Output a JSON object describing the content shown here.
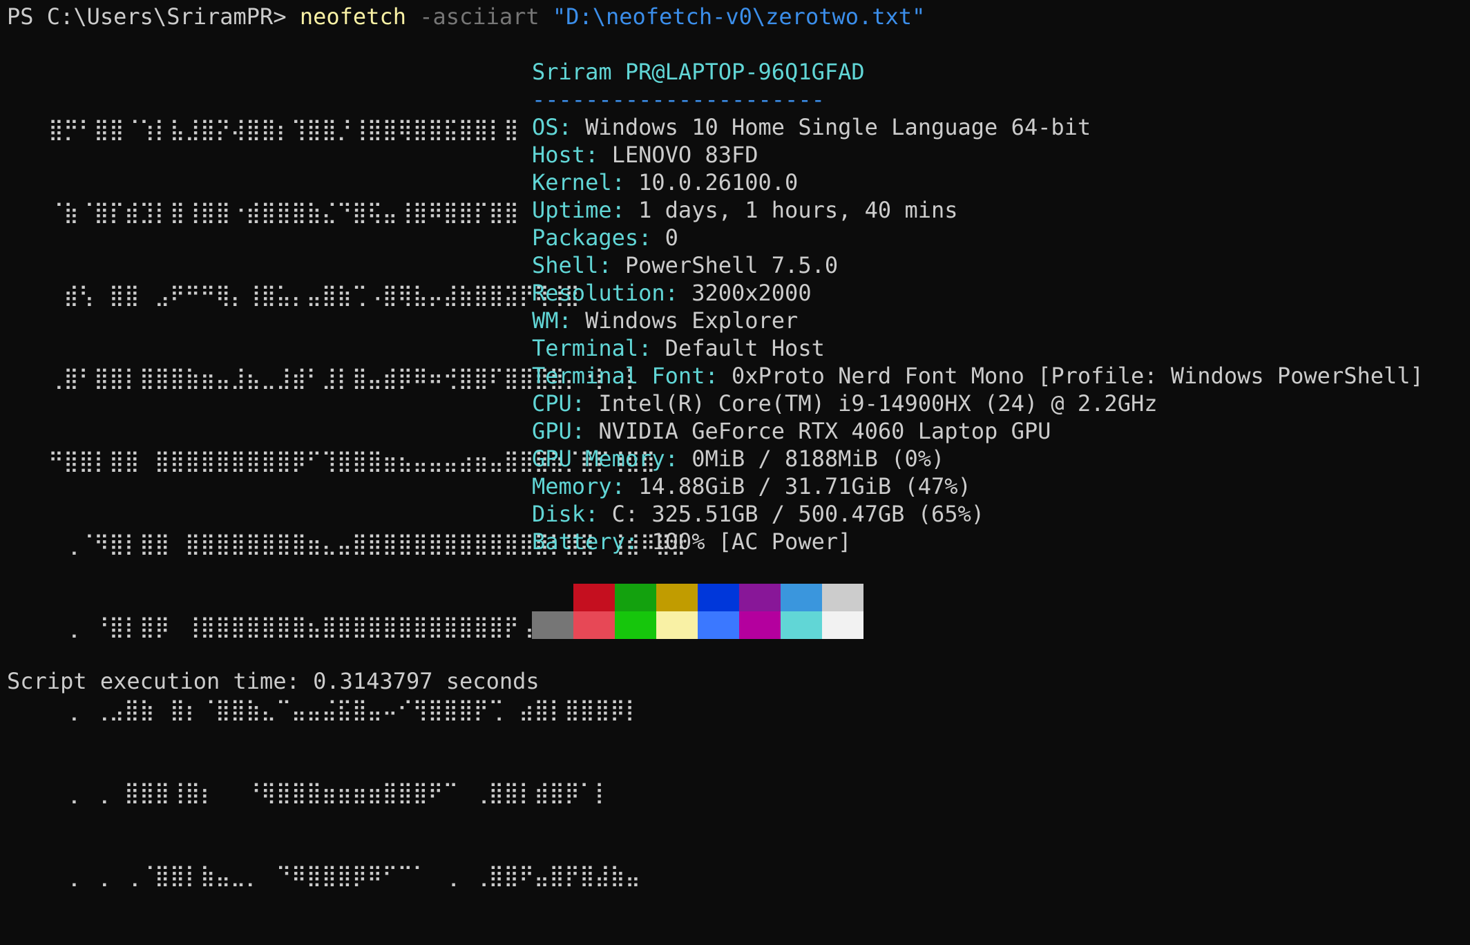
{
  "window": {
    "background": "#0c0c0c"
  },
  "prompt": {
    "ps": "PS C:\\Users\\SriramPR> ",
    "command": "neofetch",
    "flag": " -asciiart ",
    "argument": "\"D:\\neofetch-v0\\zerotwo.txt\""
  },
  "ascii_art": [
    "⣿⡛⠃⣿⣿⠈⢱⡇⣧⣸⣿⡝⢼⣿⣿⡆⢹⣿⣿⡘⢸⣿⣿⢿⣿⣿⣯⣿⣿⡇⣿",
    "⠈⣷⠈⣿⡏⣾⣹⡇⣿⢸⣿⣿⠐⣾⣿⣿⣿⣷⣌⠙⣿⢯⣤⢸⣿⠿⣿⣿⡏⣿⣿",
    "⠀⣾⢣⠀⣿⣿⠀⣠⠟⠛⠛⢿⡄⢸⣿⣥⡄⣤⣿⣷⢉⠠⣿⢿⣧⡤⣼⣷⣿⣿⣽⡟⢿⢸⣿",
    "⢀⣿⠃⣿⣿⡇⣿⣿⣿⣷⣶⣤⣸⣦⣀⣸⣾⠃⣸⡇⣿⣤⣾⡿⠿⠶⢚⣿⣿⠏⣿⣿⣿⣿⡄⠐⡇⠀⡇",
    "⠛⣿⣿⡇⣿⣿⠀⣿⣿⣿⣿⣿⣿⣿⣿⣿⡿⠋⢹⣿⣿⣿⣶⣦⣤⣤⣤⣴⣶⣤⣿⣿⣿⣷⡈⣿⡏⢸⣿⣿",
    "⠀⢀⠈⠻⣿⡇⣿⣿⠀⣿⣿⣿⣿⣿⣿⣿⣿⣶⣄⣤⣿⣿⣿⣿⣿⣿⣿⣿⣿⣿⣿⣿⣿⡇⣿⣿⠀⢸⣾⠿⣿⣿",
    "⠀⢀⠀⠘⣿⡇⣿⡿⠀⢸⣿⣿⣿⣿⣿⣿⣿⣦⣿⣿⣿⣿⣿⣿⣿⣿⣿⣿⣿⣿⡟⢠⣿⢿⣿⣿⣿⣿⠀⠀",
    "⠀⢀⠀⢀⣠⣿⣷⠀⣿⡆⠈⣿⣿⣷⣄⠉⣤⣤⣬⣯⣿⣤⠤⠊⢻⣿⣿⣿⡟⢉⠀⣴⣿⡇⣿⣿⣿⡿⡇⠀",
    "⠀⢀⠀⢀⠀⣿⣿⣿⢸⣿⡆⠀⠀⠘⢿⣿⣿⣿⣶⣶⣶⣶⣿⣿⣿⠟⠉⠀⢀⣿⣿⡇⣾⣿⡿⠁⡇⠀",
    "⠀⢀⠀⢀⠀⢀⠈⣿⣿⡇⣷⣤⣀⡀⠀⠙⠿⣿⣿⣿⡿⠿⠋⠉⠁⠀⢀⠀⢀⣿⣿⠟⣤⣿⡟⣿⣼⣷⣤"
  ],
  "info": {
    "title": "Sriram PR@LAPTOP-96Q1GFAD",
    "separator": "----------------------",
    "rows": [
      {
        "key": "OS:",
        "value": " Windows 10 Home Single Language 64-bit"
      },
      {
        "key": "Host:",
        "value": " LENOVO 83FD"
      },
      {
        "key": "Kernel:",
        "value": " 10.0.26100.0"
      },
      {
        "key": "Uptime:",
        "value": " 1 days, 1 hours, 40 mins"
      },
      {
        "key": "Packages:",
        "value": " 0"
      },
      {
        "key": "Shell:",
        "value": " PowerShell 7.5.0"
      },
      {
        "key": "Resolution:",
        "value": " 3200x2000"
      },
      {
        "key": "WM:",
        "value": " Windows Explorer"
      },
      {
        "key": "Terminal:",
        "value": " Default Host"
      },
      {
        "key": "Terminal Font:",
        "value": " 0xProto Nerd Font Mono [Profile: Windows PowerShell]"
      },
      {
        "key": "CPU:",
        "value": " Intel(R) Core(TM) i9-14900HX (24) @ 2.2GHz"
      },
      {
        "key": "GPU:",
        "value": " NVIDIA GeForce RTX 4060 Laptop GPU"
      },
      {
        "key": "GPU Memory:",
        "value": " 0MiB / 8188MiB (0%)"
      },
      {
        "key": "Memory:",
        "value": " 14.88GiB / 31.71GiB (47%)"
      },
      {
        "key": "Disk:",
        "value": " C: 325.51GB / 500.47GB (65%)"
      },
      {
        "key": "Battery:",
        "value": " 100% [AC Power]"
      }
    ]
  },
  "palette": {
    "row1": [
      "#0c0c0c",
      "#c50f1f",
      "#13a10e",
      "#c19c00",
      "#0037da",
      "#881798",
      "#3a96dd",
      "#cccccc"
    ],
    "row2": [
      "#767676",
      "#e74856",
      "#16c60c",
      "#f9f1a5",
      "#3b78ff",
      "#b4009e",
      "#61d6d6",
      "#f2f2f2"
    ]
  },
  "footer": {
    "text": "Script execution time: 0.3143797 seconds"
  }
}
